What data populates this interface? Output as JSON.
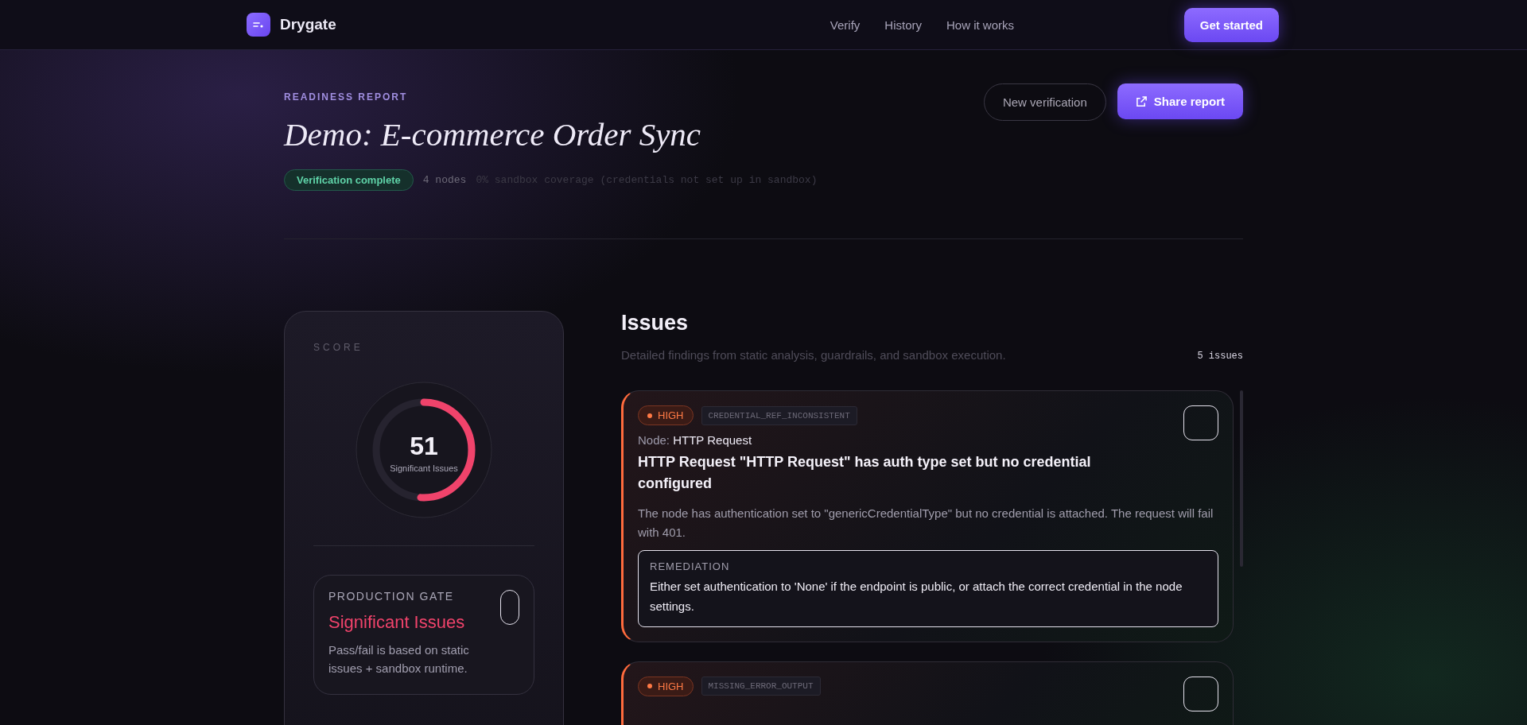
{
  "nav": {
    "brand": "Drygate",
    "links": [
      "Verify",
      "History",
      "How it works"
    ],
    "cta": "Get started"
  },
  "report": {
    "eyebrow": "READINESS REPORT",
    "title": "Demo: E-commerce Order Sync",
    "status": "Verification complete",
    "nodes": "4 nodes",
    "coverage": "0% sandbox coverage (credentials not set up in sandbox)",
    "actions": [
      {
        "label": "New verification",
        "kind": "secondary"
      },
      {
        "label": "Share report",
        "kind": "primary"
      }
    ]
  },
  "score": {
    "label": "SCORE",
    "value": "51",
    "caption": "Significant Issues",
    "level": 0.51,
    "gate": {
      "label": "PRODUCTION GATE",
      "verdict": "Significant Issues",
      "note": "Pass/fail is based on static issues + sandbox runtime."
    }
  },
  "issues": {
    "title": "Issues",
    "subtitle": "Detailed findings from static analysis, guardrails, and sandbox execution.",
    "count": "5 issues",
    "items": [
      {
        "severity": "HIGH",
        "code": "CREDENTIAL_REF_INCONSISTENT",
        "node_label": "Node:",
        "node": "HTTP Request",
        "headline": "HTTP Request \"HTTP Request\" has auth type set but no credential configured",
        "detail": "The node has authentication set to \"genericCredentialType\" but no credential is attached. The request will fail with 401.",
        "remediation_label": "REMEDIATION",
        "remediation": "Either set authentication to 'None' if the endpoint is public, or attach the correct credential in the node settings."
      },
      {
        "severity": "HIGH",
        "code": "MISSING_ERROR_OUTPUT"
      }
    ]
  }
}
